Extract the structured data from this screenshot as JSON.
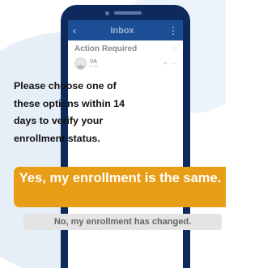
{
  "header": {
    "back_icon": "chevron-left-icon",
    "title": "Inbox",
    "menu_icon": "more-vertical-icon"
  },
  "email": {
    "subject": "Action Required",
    "sender": "VA",
    "sender_sub": "to me",
    "body": "Please choose one of these options within 14 days to verify your enrollment status."
  },
  "actions": {
    "primary_label": "Yes, my enrollment is the same.",
    "secondary_label": "No, my enrollment has changed."
  },
  "colors": {
    "phone_frame": "#0e2a5c",
    "app_bar": "#1c4e96",
    "primary_button": "#e89d16",
    "secondary_button": "#e4e4e4",
    "background_blob": "#e6eef7"
  }
}
